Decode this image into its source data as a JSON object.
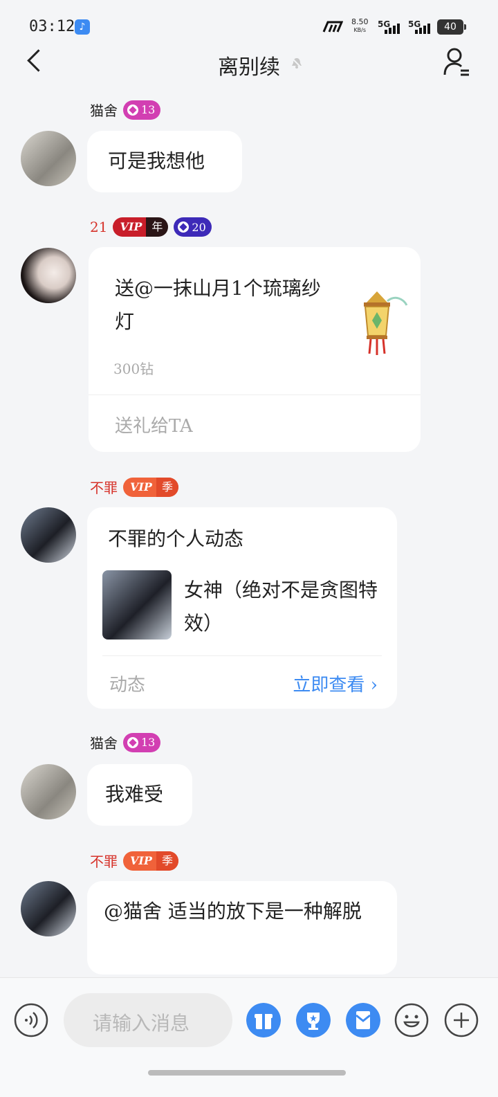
{
  "status_bar": {
    "time": "03:12",
    "net_speed_value": "8.50",
    "net_speed_unit": "KB/s",
    "sim1": "5G",
    "sim2": "5G",
    "battery": "40"
  },
  "header": {
    "title": "离别续"
  },
  "messages": [
    {
      "sender": "猫舍",
      "level": "13",
      "text": "可是我想他"
    },
    {
      "sender": "21",
      "vip_label": "VIP",
      "vip_term": "年",
      "level": "20",
      "gift_text": "送@一抹山月1个琉璃纱灯",
      "gift_price": "300钻",
      "gift_action": "送礼给TA"
    },
    {
      "sender": "不罪",
      "vip_label": "VIP",
      "vip_term": "季",
      "card_title": "不罪的个人动态",
      "card_post_text": "女神（绝对不是贪图特效）",
      "card_footer_left": "动态",
      "card_footer_action": "立即查看"
    },
    {
      "sender": "猫舍",
      "level": "13",
      "text": "我难受"
    },
    {
      "sender": "不罪",
      "vip_label": "VIP",
      "vip_term": "季",
      "text": "@猫舍 适当的放下是一种解脱"
    }
  ],
  "input": {
    "placeholder": "请输入消息"
  },
  "colors": {
    "level_pink": "#d23fb2",
    "level_purple": "#3d2ab8",
    "vip_red": "#d6322a",
    "vip_orange": "#f0623a",
    "link_blue": "#3d8bf2",
    "toolbar_blue": "#3d8bf2"
  },
  "icons": [
    "back-arrow-icon",
    "bell-muted-icon",
    "group-member-icon",
    "voice-icon",
    "gift-icon",
    "trophy-icon",
    "red-packet-icon",
    "emoji-icon",
    "plus-icon",
    "lantern-icon"
  ]
}
